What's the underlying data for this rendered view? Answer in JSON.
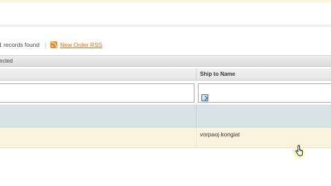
{
  "toolbar": {
    "records_found": "1 records found",
    "separator": "|",
    "rss_label": "New Order RSS"
  },
  "massaction": {
    "selected_text": "ected"
  },
  "grid": {
    "columns": [
      {
        "label": "Ship to Name"
      }
    ],
    "rows": [
      {
        "ship_to_name": "vorpaoj kongiat"
      }
    ]
  },
  "colors": {
    "rss_link": "#e26b1b",
    "data_row_bg": "#fbf3dd",
    "empty_row_bg": "#d7e3e5"
  },
  "icons": [
    "rss-icon",
    "calendar-icon",
    "pointer-hand-icon"
  ]
}
